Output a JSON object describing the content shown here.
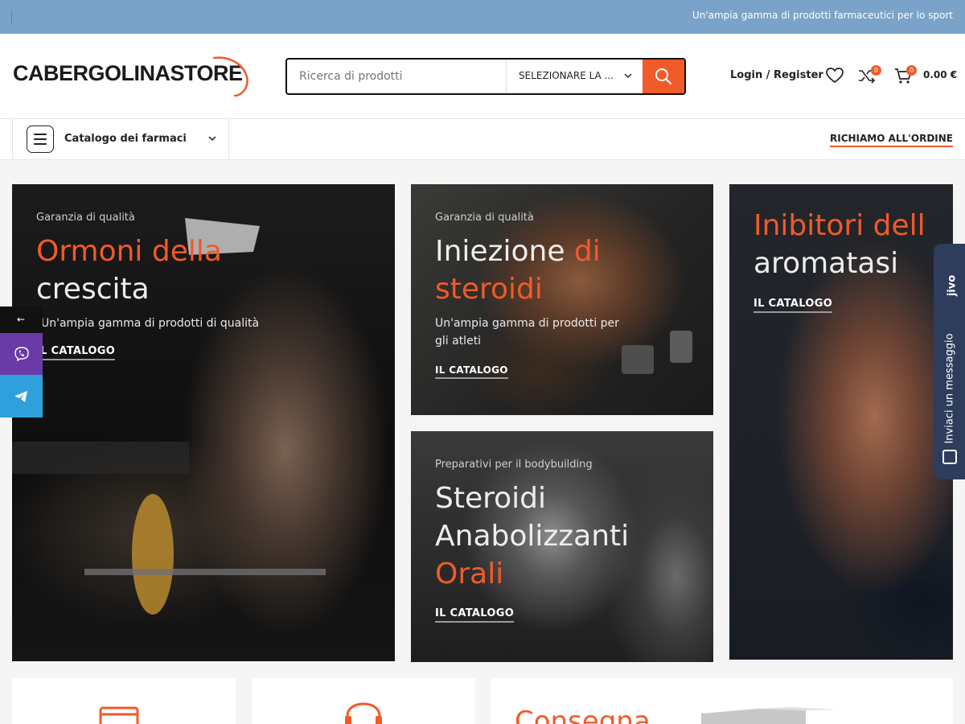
{
  "topbar": {
    "tagline": "Un'ampia gamma di prodotti farmaceutici per lo sport"
  },
  "header": {
    "logo_text": "CABERGOLINASTORE",
    "search": {
      "placeholder": "Ricerca di prodotti",
      "category_label": "SELEZIONARE LA ..."
    },
    "login_label": "Login / Register",
    "compare_count": "0",
    "cart_count": "0",
    "cart_total": "0.00 €"
  },
  "nav": {
    "catalog_label": "Catalogo dei farmaci",
    "callback_label": "RICHIAMO ALL'ORDINE"
  },
  "banners": {
    "growth": {
      "subtitle": "Garanzia di qualità",
      "title_hl": "Ormoni della",
      "title_rest": "crescita",
      "desc": "Un'ampia gamma di prodotti di qualità",
      "cta": "IL CATALOGO"
    },
    "injection": {
      "subtitle": "Garanzia di qualità",
      "title_a": "Iniezione ",
      "title_hl1": "di",
      "title_hl2": "steroidi",
      "desc_line1": "Un'ampia gamma di prodotti per",
      "desc_line2": "gli atleti",
      "cta": "IL CATALOGO"
    },
    "aromatase": {
      "title_hl": "Inibitori dell",
      "title_rest": "aromatasi",
      "cta": "IL CATALOGO"
    },
    "oral": {
      "subtitle": "Preparativi per il bodybuilding",
      "title_line1": "Steroidi",
      "title_line2": "Anabolizzanti",
      "title_hl": "Orali",
      "cta": "IL CATALOGO"
    }
  },
  "side": {
    "arrow": "←"
  },
  "jivo": {
    "brand": "jivo",
    "message": "Inviaci un messaggio"
  },
  "features": {
    "delivery_title": "Consegna"
  },
  "colors": {
    "accent": "#f15a29",
    "topbar": "#7ba3c9",
    "jivo": "#2f3d5c",
    "viber": "#6a3aa6",
    "telegram": "#2ea0dc"
  },
  "icons": [
    "heart-icon",
    "compare-icon",
    "cart-icon",
    "search-icon",
    "menu-icon",
    "chevron-down-icon",
    "viber-icon",
    "telegram-icon",
    "arrow-left-icon",
    "chat-icon"
  ]
}
